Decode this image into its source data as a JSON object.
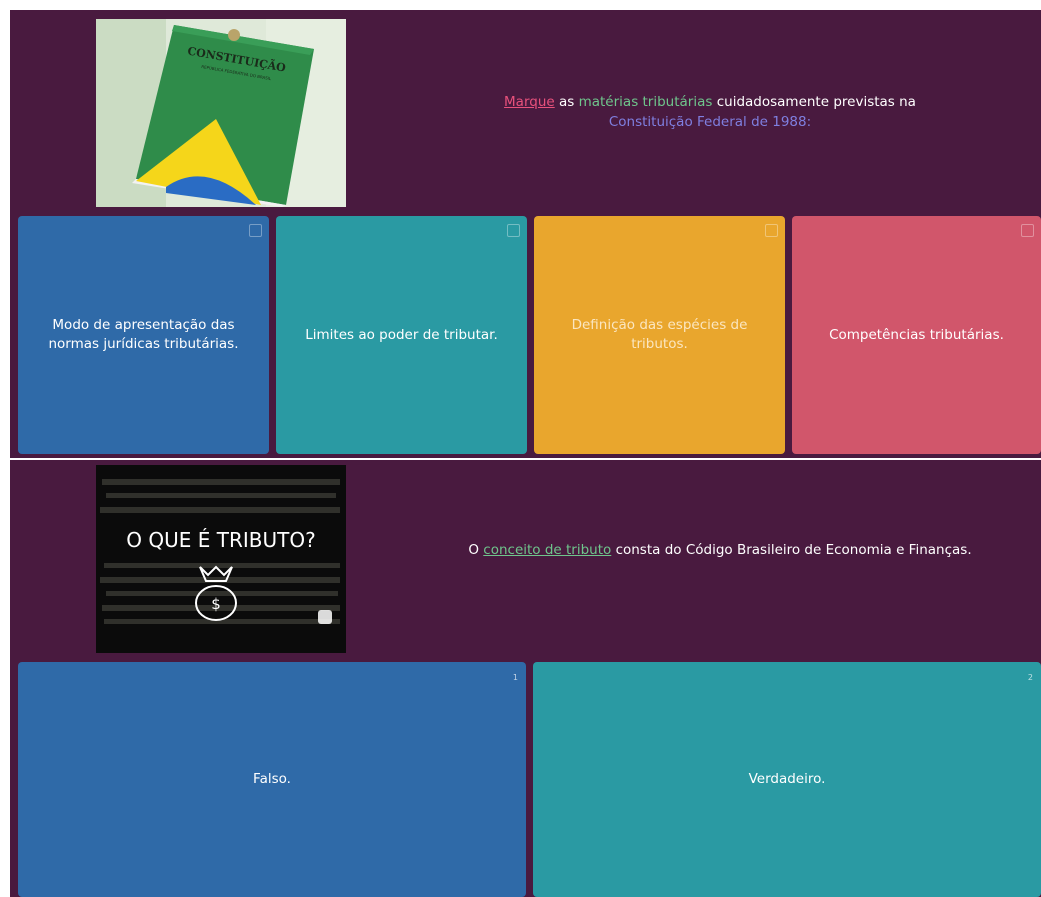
{
  "question1": {
    "text_parts": {
      "marque": "Marque",
      "as": " as ",
      "materias": "matérias tributárias",
      "cuidadosamente": " cuidadosamente previstas na ",
      "constituicao": "Constituição Federal de 1988:"
    },
    "image": {
      "title": "CONSTITUIÇÃO",
      "subtitle": "REPÚBLICA FEDERATIVA DO BRASIL"
    },
    "answers": [
      {
        "label": "Modo de apresentação das normas jurídicas tributárias.",
        "color": "#2f6aa8"
      },
      {
        "label": "Limites ao poder de tributar.",
        "color": "#2a9aa3"
      },
      {
        "label": "Definição das espécies de tributos.",
        "color": "#e9a62d"
      },
      {
        "label": "Competências tributárias.",
        "color": "#d1566b"
      }
    ]
  },
  "question2": {
    "text_parts": {
      "o": "O ",
      "conceito": "conceito de tributo",
      "rest": " consta do Código Brasileiro de Economia e Finanças."
    },
    "image": {
      "caption": "O QUE É TRIBUTO?",
      "icon": "money-bag-icon"
    },
    "answers": [
      {
        "label": "Falso.",
        "number": "1",
        "color": "#2f6aa8"
      },
      {
        "label": "Verdadeiro.",
        "number": "2",
        "color": "#2a9aa3"
      }
    ]
  },
  "colors": {
    "panel_bg": "#491a3f",
    "accent_pink": "#e8517c",
    "accent_green": "#6fc58c",
    "accent_blue": "#7f7fe0"
  }
}
